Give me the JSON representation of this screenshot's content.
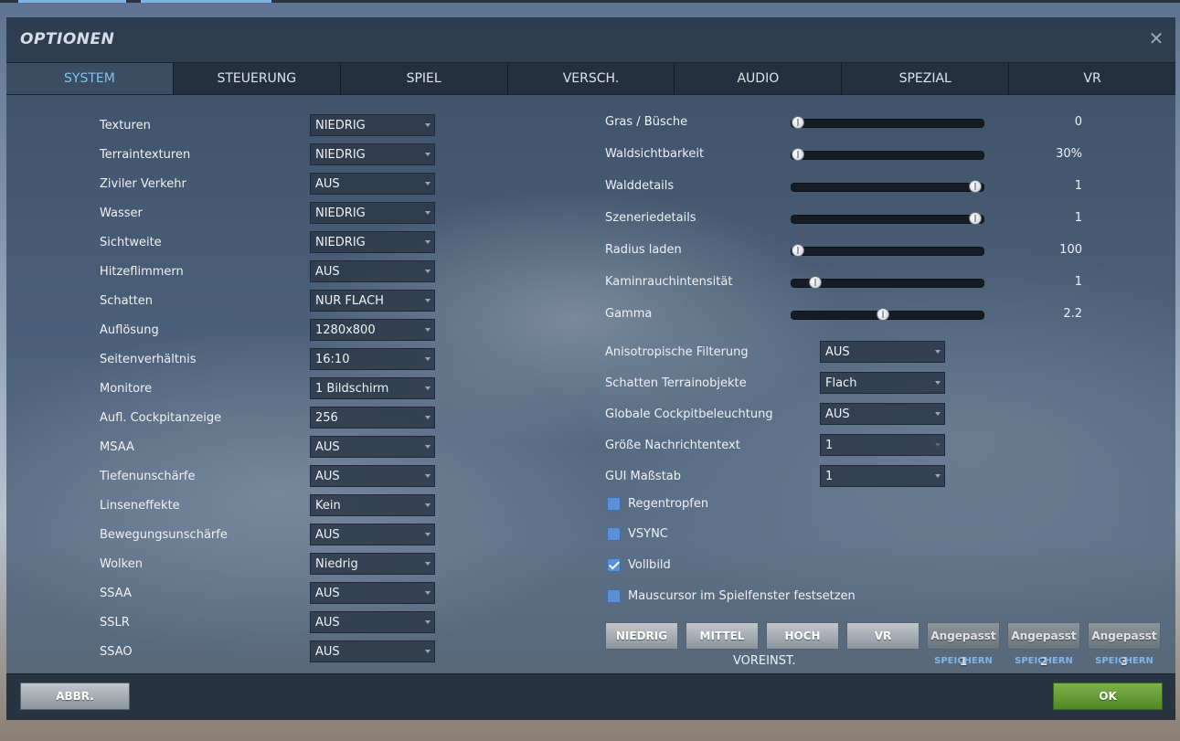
{
  "window": {
    "title": "OPTIONEN",
    "close_icon": "close-icon"
  },
  "tabs": [
    {
      "label": "SYSTEM",
      "active": true
    },
    {
      "label": "STEUERUNG",
      "active": false
    },
    {
      "label": "SPIEL",
      "active": false
    },
    {
      "label": "VERSCH.",
      "active": false
    },
    {
      "label": "AUDIO",
      "active": false
    },
    {
      "label": "SPEZIAL",
      "active": false
    },
    {
      "label": "VR",
      "active": false
    }
  ],
  "left_settings": [
    {
      "label": "Texturen",
      "value": "NIEDRIG"
    },
    {
      "label": "Terraintexturen",
      "value": "NIEDRIG"
    },
    {
      "label": "Ziviler Verkehr",
      "value": "AUS"
    },
    {
      "label": "Wasser",
      "value": "NIEDRIG"
    },
    {
      "label": "Sichtweite",
      "value": "NIEDRIG"
    },
    {
      "label": "Hitzeflimmern",
      "value": "AUS"
    },
    {
      "label": "Schatten",
      "value": "NUR FLACH"
    },
    {
      "label": "Auflösung",
      "value": "1280x800"
    },
    {
      "label": "Seitenverhältnis",
      "value": "16:10"
    },
    {
      "label": "Monitore",
      "value": "1 Bildschirm"
    },
    {
      "label": "Aufl. Cockpitanzeige",
      "value": "256"
    },
    {
      "label": "MSAA",
      "value": "AUS"
    },
    {
      "label": "Tiefenunschärfe",
      "value": "AUS"
    },
    {
      "label": "Linseneffekte",
      "value": "Kein"
    },
    {
      "label": "Bewegungsunschärfe",
      "value": "AUS"
    },
    {
      "label": "Wolken",
      "value": "Niedrig"
    },
    {
      "label": "SSAA",
      "value": "AUS"
    },
    {
      "label": "SSLR",
      "value": "AUS"
    },
    {
      "label": "SSAO",
      "value": "AUS"
    }
  ],
  "sliders": [
    {
      "label": "Gras / Büsche",
      "value": "0",
      "position": 0.0
    },
    {
      "label": "Waldsichtbarkeit",
      "value": "30%",
      "position": 0.0
    },
    {
      "label": "Walddetails",
      "value": "1",
      "position": 1.0
    },
    {
      "label": "Szeneriedetails",
      "value": "1",
      "position": 1.0
    },
    {
      "label": "Radius laden",
      "value": "100",
      "position": 0.0
    },
    {
      "label": "Kaminrauchintensität",
      "value": "1",
      "position": 0.1
    },
    {
      "label": "Gamma",
      "value": "2.2",
      "position": 0.48
    }
  ],
  "right_dropdowns": [
    {
      "label": "Anisotropische Filterung",
      "value": "AUS",
      "enabled": true
    },
    {
      "label": "Schatten Terrainobjekte",
      "value": "Flach",
      "enabled": true
    },
    {
      "label": "Globale Cockpitbeleuchtung",
      "value": "AUS",
      "enabled": true
    },
    {
      "label": "Größe Nachrichtentext",
      "value": "1",
      "enabled": false
    },
    {
      "label": "GUI Maßstab",
      "value": "1",
      "enabled": true
    }
  ],
  "checkboxes": [
    {
      "label": "Regentropfen",
      "checked": false
    },
    {
      "label": "VSYNC",
      "checked": false
    },
    {
      "label": "Vollbild",
      "checked": true
    },
    {
      "label": "Mauscursor im Spielfenster festsetzen",
      "checked": false
    }
  ],
  "presets": {
    "buttons": [
      "NIEDRIG",
      "MITTEL",
      "HOCH",
      "VR"
    ],
    "caption": "VOREINST.",
    "custom": [
      {
        "label": "Angepasst 1",
        "save": "SPEICHERN"
      },
      {
        "label": "Angepasst 2",
        "save": "SPEICHERN"
      },
      {
        "label": "Angepasst 3",
        "save": "SPEICHERN"
      }
    ]
  },
  "footer": {
    "cancel": "ABBR.",
    "ok": "OK"
  },
  "colors": {
    "accent_tab": "#7fc4ee",
    "ok_green": "#6aa23a",
    "checkbox": "#5b8fd6",
    "save_link": "#7fb6ea"
  }
}
